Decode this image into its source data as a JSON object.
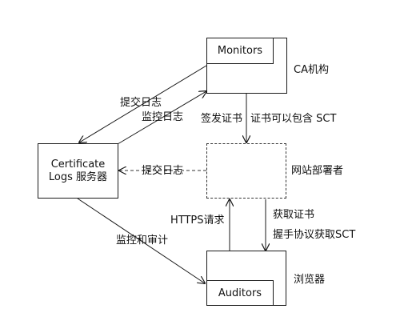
{
  "nodes": {
    "ca": {
      "outer_label": "CA机构",
      "inner_label": "Monitors"
    },
    "logs": {
      "line1": "Certificate",
      "line2": "Logs 服务器"
    },
    "website": {
      "label": "网站部署者"
    },
    "browser": {
      "outer_label": "浏览器",
      "inner_label": "Auditors"
    }
  },
  "edges": {
    "submit_log_ca": "提交日志",
    "monitor_log": "监控日志",
    "issue_cert": "签发证书",
    "cert_may_include_sct": "证书可以包含 SCT",
    "submit_log_site": "提交日志",
    "https_request": "HTTPS请求",
    "get_cert": "获取证书",
    "handshake_sct": "握手协议获取SCT",
    "monitor_audit": "监控和审计"
  },
  "colors": {
    "line": "#1a1a1a",
    "text": "#111111",
    "dashed": "#333333"
  }
}
